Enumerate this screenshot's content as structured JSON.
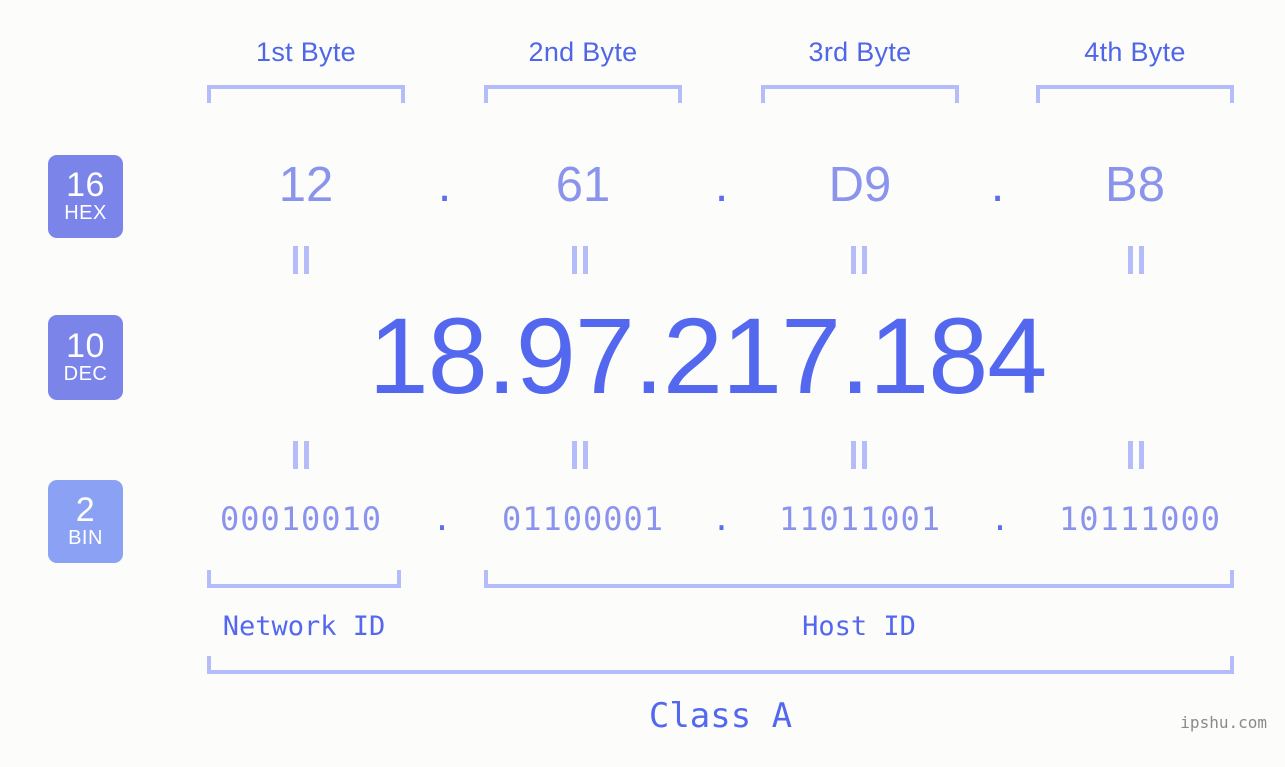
{
  "background_color": "#fcfdfa",
  "accent_colors": {
    "badge_hex": "#7b84e8",
    "badge_dec": "#7b84e8",
    "badge_bin": "#8ba1f3",
    "bracket": "#b4bdfa",
    "header_text": "#4f66e8",
    "hex_text": "#8b94ec",
    "dec_text": "#5468ef",
    "bin_text": "#8b94ec",
    "dot_text": "#5b6ef0",
    "label_text": "#5468ef",
    "watermark_text": "#8a8a8a"
  },
  "header": {
    "byte_labels": [
      "1st Byte",
      "2nd Byte",
      "3rd Byte",
      "4th Byte"
    ]
  },
  "rows": {
    "hex": {
      "badge_number": "16",
      "badge_name": "HEX",
      "octets": [
        "12",
        "61",
        "D9",
        "B8"
      ],
      "separator": "."
    },
    "dec": {
      "badge_number": "10",
      "badge_name": "DEC",
      "octets": [
        "18",
        "97",
        "217",
        "184"
      ],
      "separator": ".",
      "full_value": "18.97.217.184"
    },
    "bin": {
      "badge_number": "2",
      "badge_name": "BIN",
      "octets": [
        "00010010",
        "01100001",
        "11011001",
        "10111000"
      ],
      "separator": "."
    }
  },
  "equals_marks": {
    "glyph": "=",
    "count_per_row": 4
  },
  "id_sections": {
    "network_id_label": "Network ID",
    "host_id_label": "Host ID"
  },
  "class_section": {
    "label": "Class A"
  },
  "watermark": {
    "text": "ipshu.com"
  }
}
